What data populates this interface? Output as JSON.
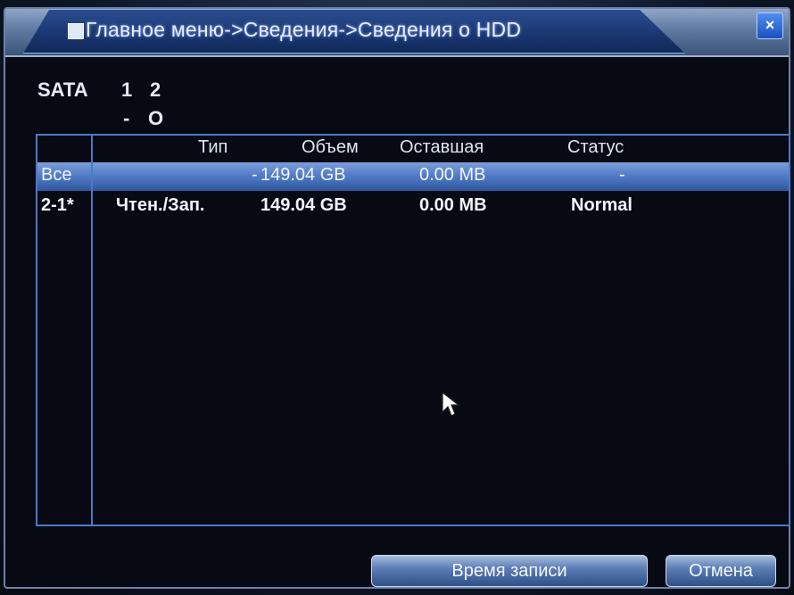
{
  "window": {
    "breadcrumb": "Главное меню->Сведения->Сведения о HDD",
    "close_label": "×"
  },
  "sata": {
    "label": "SATA",
    "ports": [
      "1",
      "2"
    ],
    "states": [
      "-",
      "O"
    ]
  },
  "table": {
    "headers": [
      "Тип",
      "Объем",
      "Оставшая",
      "Статус"
    ],
    "rows": [
      {
        "name": "Все",
        "type": "-",
        "volume": "149.04 GB",
        "remaining": "0.00 MB",
        "status": "-"
      },
      {
        "name": "2-1*",
        "type": "Чтен./Зап.",
        "volume": "149.04 GB",
        "remaining": "0.00 MB",
        "status": "Normal"
      }
    ],
    "selected_row": 0
  },
  "buttons": {
    "record_time": "Время записи",
    "cancel": "Отмена"
  },
  "colors": {
    "accent": "#4d78c8",
    "selection": "#5b86d0",
    "text": "#e4ebf8",
    "background": "#070a12"
  }
}
